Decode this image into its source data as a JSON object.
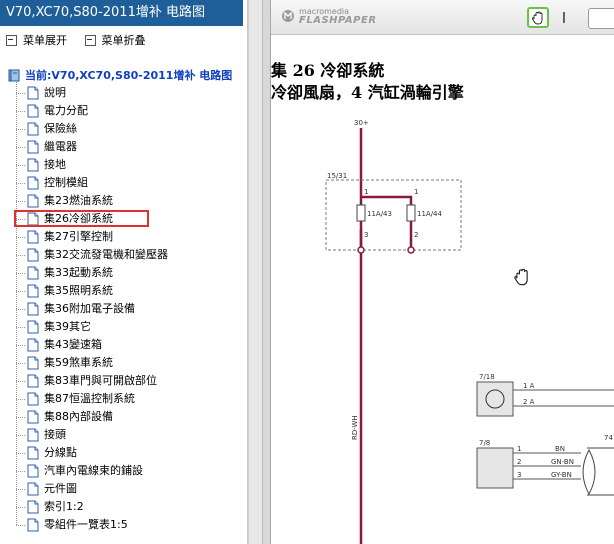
{
  "left_pane": {
    "title": "V70,XC70,S80-2011增补 电路图",
    "toolbar": {
      "expand_label": "菜单展开",
      "collapse_label": "菜单折叠"
    },
    "tree_root": "当前:V70,XC70,S80-2011增补 电路图",
    "items": [
      {
        "label": "說明"
      },
      {
        "label": "電力分配"
      },
      {
        "label": "保險絲"
      },
      {
        "label": "繼電器"
      },
      {
        "label": "接地"
      },
      {
        "label": "控制模組"
      },
      {
        "label": "集23燃油系統"
      },
      {
        "label": "集26冷卻系統",
        "selected": true
      },
      {
        "label": "集27引擎控制"
      },
      {
        "label": "集32交流發電機和變壓器"
      },
      {
        "label": "集33起動系統"
      },
      {
        "label": "集35照明系統"
      },
      {
        "label": "集36附加電子設備"
      },
      {
        "label": "集39其它"
      },
      {
        "label": "集43變速箱"
      },
      {
        "label": "集59煞車系統"
      },
      {
        "label": "集83車門與可開啟部位"
      },
      {
        "label": "集87恒溫控制系統"
      },
      {
        "label": "集88內部設備"
      },
      {
        "label": "接頭"
      },
      {
        "label": "分線點"
      },
      {
        "label": "汽車內電線束的鋪設"
      },
      {
        "label": "元件圖"
      },
      {
        "label": "索引1:2"
      },
      {
        "label": "零組件一覽表1:5"
      }
    ]
  },
  "viewer": {
    "brand_line1": "macromedia",
    "brand_line2": "FLASHPAPER",
    "tools": {
      "hand_icon": "hand-icon",
      "text_select_icon": "i-beam-icon"
    },
    "selection_color": "#e03030",
    "doc": {
      "title_line1": "集 26 冷卻系統",
      "title_line2": "冷卻風扇，4 汽缸渦輪引擎"
    },
    "diagram": {
      "supply_label": "30+",
      "fuse_box_label": "15/31",
      "fuse1_label": "11A/43",
      "fuse2_label": "11A/44",
      "pin_labels": [
        "1",
        "1",
        "3",
        "2"
      ],
      "wire_label": "RD-WH",
      "comp1_label": "7/18",
      "comp1_pins": [
        "1 A",
        "2 A"
      ],
      "comp2_label": "7/8",
      "comp2_pins": [
        "1",
        "2",
        "3"
      ],
      "comp2_wires": [
        "BN",
        "GN-BN",
        "GY-BN"
      ],
      "comp3_label": "74"
    }
  }
}
